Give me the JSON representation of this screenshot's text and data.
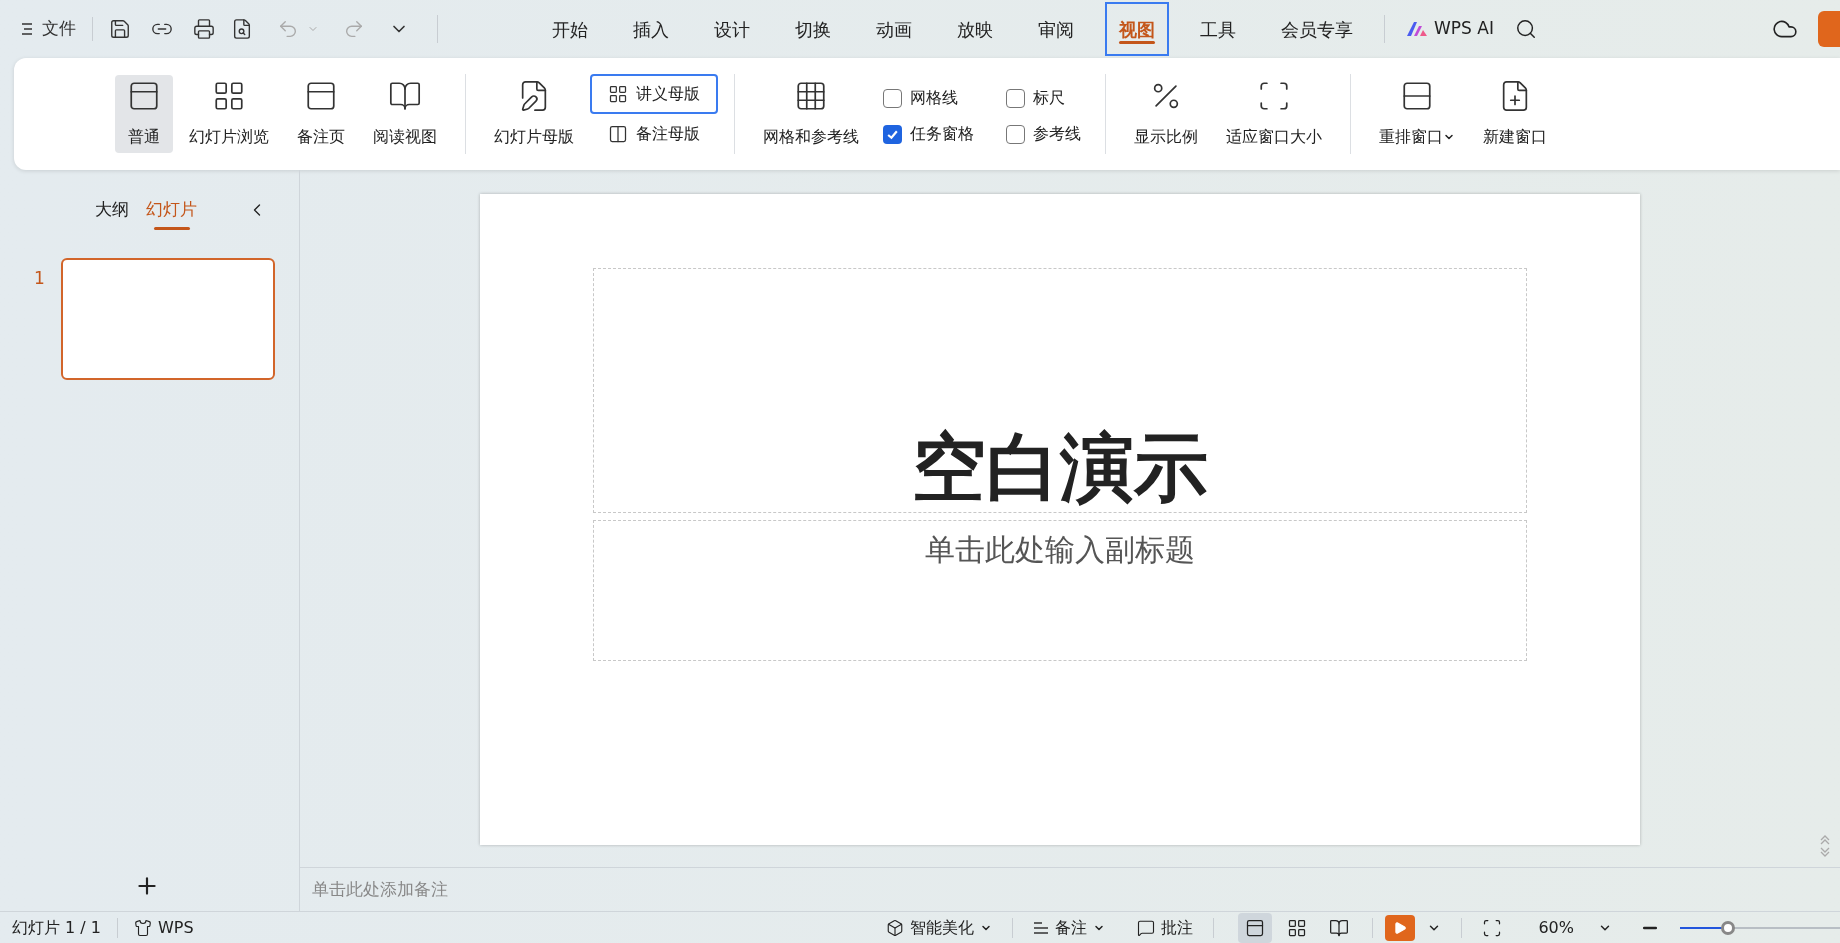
{
  "menu": {
    "file": "文件"
  },
  "tabs": [
    {
      "label": "开始",
      "selected": false,
      "highlighted": false
    },
    {
      "label": "插入",
      "selected": false,
      "highlighted": false
    },
    {
      "label": "设计",
      "selected": false,
      "highlighted": false
    },
    {
      "label": "切换",
      "selected": false,
      "highlighted": false
    },
    {
      "label": "动画",
      "selected": false,
      "highlighted": false
    },
    {
      "label": "放映",
      "selected": false,
      "highlighted": false
    },
    {
      "label": "审阅",
      "selected": false,
      "highlighted": false
    },
    {
      "label": "视图",
      "selected": true,
      "highlighted": true
    },
    {
      "label": "工具",
      "selected": false,
      "highlighted": false
    },
    {
      "label": "会员专享",
      "selected": false,
      "highlighted": false
    }
  ],
  "ai_button": "WPS AI",
  "ribbon": {
    "groups": [
      {
        "items": [
          {
            "kind": "large",
            "label": "普通",
            "selected": true
          },
          {
            "kind": "large",
            "label": "幻灯片浏览",
            "selected": false
          },
          {
            "kind": "large",
            "label": "备注页",
            "selected": false
          },
          {
            "kind": "large",
            "label": "阅读视图",
            "selected": false
          }
        ]
      },
      {
        "items": [
          {
            "kind": "large",
            "label": "幻灯片母版"
          }
        ],
        "sub_items": [
          {
            "kind": "small",
            "label": "讲义母版",
            "highlighted": true
          },
          {
            "kind": "small",
            "label": "备注母版",
            "highlighted": false
          }
        ]
      },
      {
        "items": [
          {
            "kind": "large",
            "label": "网格和参考线"
          }
        ],
        "sub_items": [
          {
            "kind": "checkbox",
            "label": "网格线",
            "checked": false
          },
          {
            "kind": "checkbox",
            "label": "标尺",
            "checked": false
          },
          {
            "kind": "checkbox",
            "label": "任务窗格",
            "checked": true
          },
          {
            "kind": "checkbox",
            "label": "参考线",
            "checked": false
          }
        ]
      },
      {
        "items": [
          {
            "kind": "large",
            "label": "显示比例"
          },
          {
            "kind": "large",
            "label": "适应窗口大小"
          }
        ]
      },
      {
        "items": [
          {
            "kind": "large",
            "label": "重排窗口",
            "dropdown": true
          },
          {
            "kind": "large",
            "label": "新建窗口",
            "dropdown": false
          }
        ]
      }
    ]
  },
  "panel": {
    "tabs": [
      {
        "label": "大纲",
        "selected": false
      },
      {
        "label": "幻灯片",
        "selected": true
      }
    ],
    "slides": [
      {
        "number": "1",
        "selected": true
      }
    ]
  },
  "slide": {
    "title": "空白演示",
    "subtitle": "单击此处输入副标题"
  },
  "notes": {
    "placeholder": "单击此处添加备注"
  },
  "status_bar": {
    "slide_count": "幻灯片 1 / 1",
    "theme": "WPS",
    "beautify": "智能美化",
    "notes": "备注",
    "comments": "批注",
    "views": [
      {
        "selected": true
      },
      {
        "selected": false
      },
      {
        "selected": false
      }
    ],
    "zoom": "60%",
    "zoom_slider": {
      "level": 0.3
    }
  }
}
